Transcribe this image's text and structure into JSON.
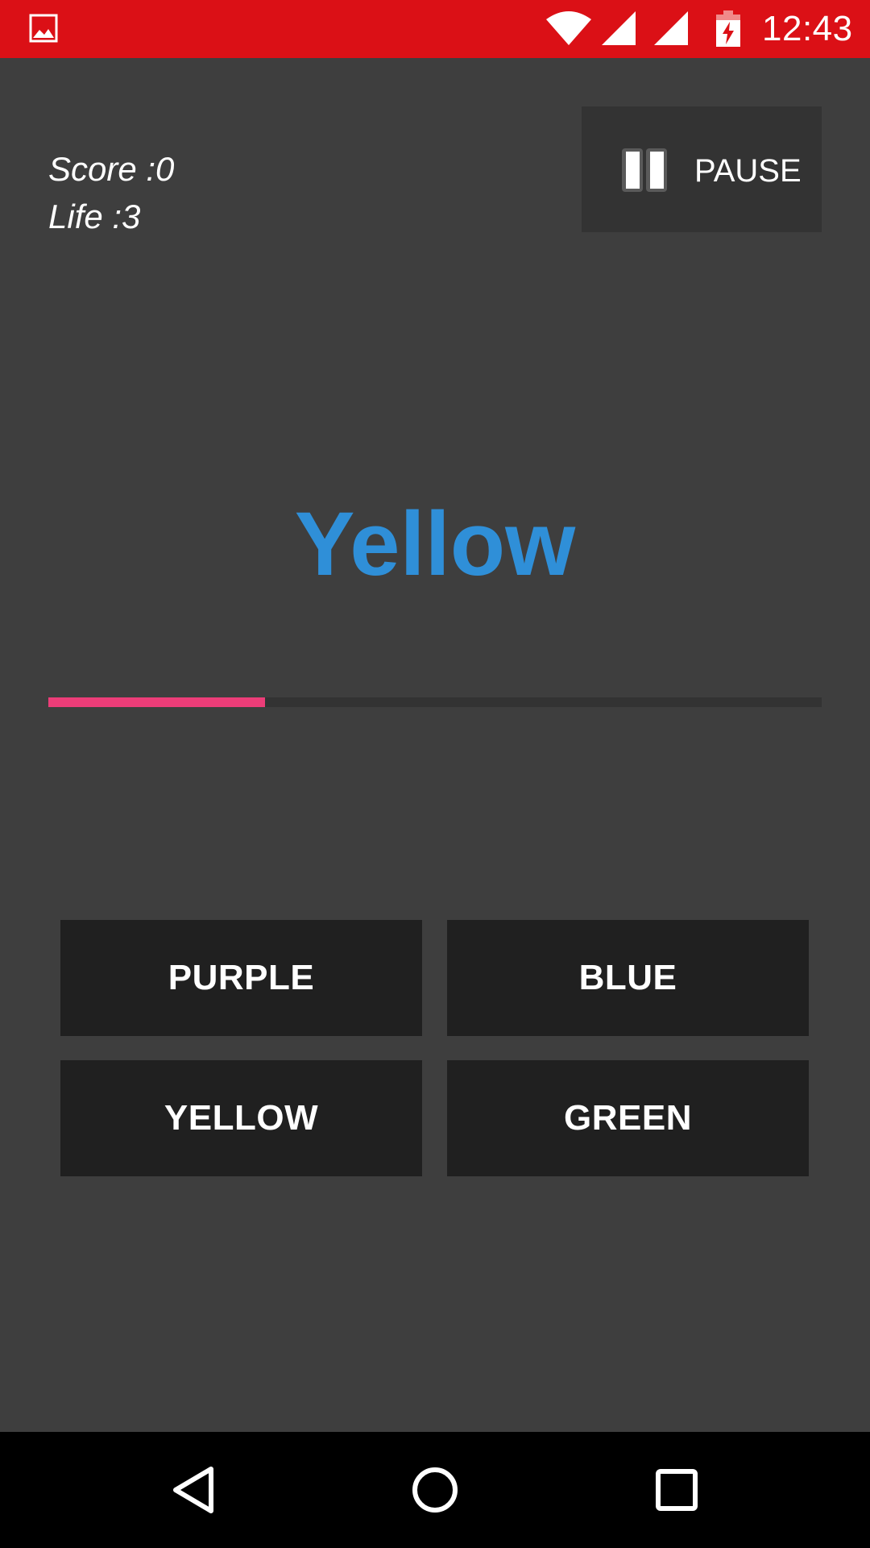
{
  "status_bar": {
    "time": "12:43",
    "icons": [
      "gallery-icon",
      "wifi-icon",
      "signal-icon",
      "signal-icon",
      "battery-charging-icon"
    ],
    "background_color": "#db1016"
  },
  "hud": {
    "score_text": "Score :0",
    "life_text": "Life :3"
  },
  "pause_button": {
    "label": "PAUSE",
    "icon": "pause-icon"
  },
  "target_word": {
    "text": "Yellow",
    "color": "#2f8fd8"
  },
  "timer": {
    "progress": 0.28,
    "fill_color": "#ec3d78",
    "track_color": "#333333"
  },
  "answers": [
    {
      "label": "PURPLE"
    },
    {
      "label": "BLUE"
    },
    {
      "label": "YELLOW"
    },
    {
      "label": "GREEN"
    }
  ],
  "nav_bar": {
    "icons": [
      "back-icon",
      "home-icon",
      "recents-icon"
    ]
  }
}
